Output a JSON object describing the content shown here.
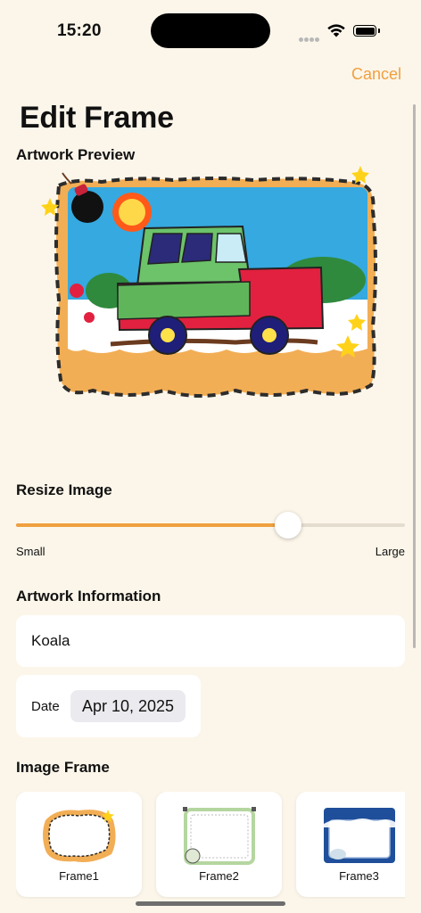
{
  "status": {
    "time": "15:20"
  },
  "nav": {
    "cancel_label": "Cancel",
    "title": "Edit Frame"
  },
  "preview": {
    "label": "Artwork Preview"
  },
  "resize": {
    "label": "Resize Image",
    "min_label": "Small",
    "max_label": "Large",
    "value": 0.7
  },
  "info": {
    "label": "Artwork Information",
    "name": "Koala",
    "date_label": "Date",
    "date_value": "Apr 10, 2025"
  },
  "frames": {
    "label": "Image Frame",
    "items": [
      {
        "label": "Frame1"
      },
      {
        "label": "Frame2"
      },
      {
        "label": "Frame3"
      }
    ]
  },
  "colors": {
    "accent": "#f0a040",
    "background": "#fcf6ea",
    "card": "#ffffff"
  }
}
